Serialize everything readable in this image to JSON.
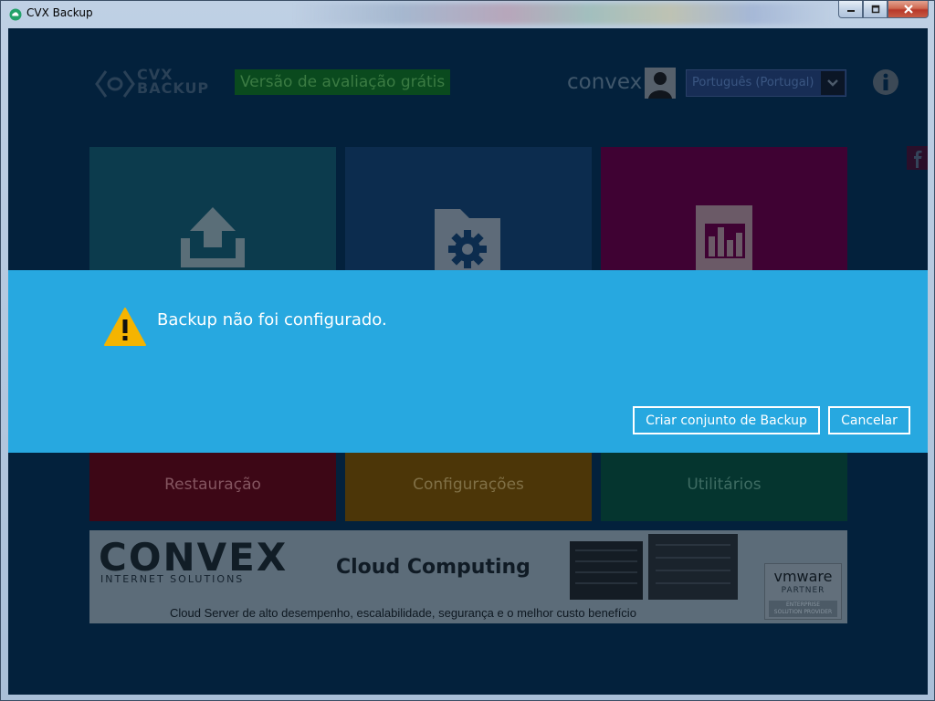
{
  "window": {
    "title": "CVX Backup"
  },
  "header": {
    "logo_lines": [
      "CVX",
      "BACKUP"
    ],
    "trial_badge": "Versão de avaliação grátis",
    "username": "convex",
    "language": "Português (Portugal)"
  },
  "tiles": [
    {
      "id": "backup",
      "icon": "upload-icon",
      "label": ""
    },
    {
      "id": "backup-sets",
      "icon": "folder-gear-icon",
      "label": ""
    },
    {
      "id": "reports",
      "icon": "bar-chart-icon",
      "label": ""
    },
    {
      "id": "restore",
      "icon": "restore-icon",
      "label": "Restauração"
    },
    {
      "id": "settings",
      "icon": "wrench-icon",
      "label": "Configurações"
    },
    {
      "id": "utilities",
      "icon": "tools-icon",
      "label": "Utilitários"
    }
  ],
  "banner": {
    "brand": "CONVEX",
    "brand_sub": "INTERNET SOLUTIONS",
    "title": "Cloud Computing",
    "caption": "Cloud Server de alto desempenho, escalabilidade, segurança e o melhor custo benefício",
    "vmware_logo": "vmware",
    "vmware_partner": "PARTNER",
    "vmware_tag": [
      "ENTERPRISE",
      "SOLUTION PROVIDER"
    ]
  },
  "modal": {
    "message": "Backup não foi configurado.",
    "primary_label": "Criar conjunto de Backup",
    "cancel_label": "Cancelar"
  },
  "colors": {
    "modal_bg": "#27a8e0",
    "app_bg": "#03213c",
    "warning": "#f5b400"
  }
}
